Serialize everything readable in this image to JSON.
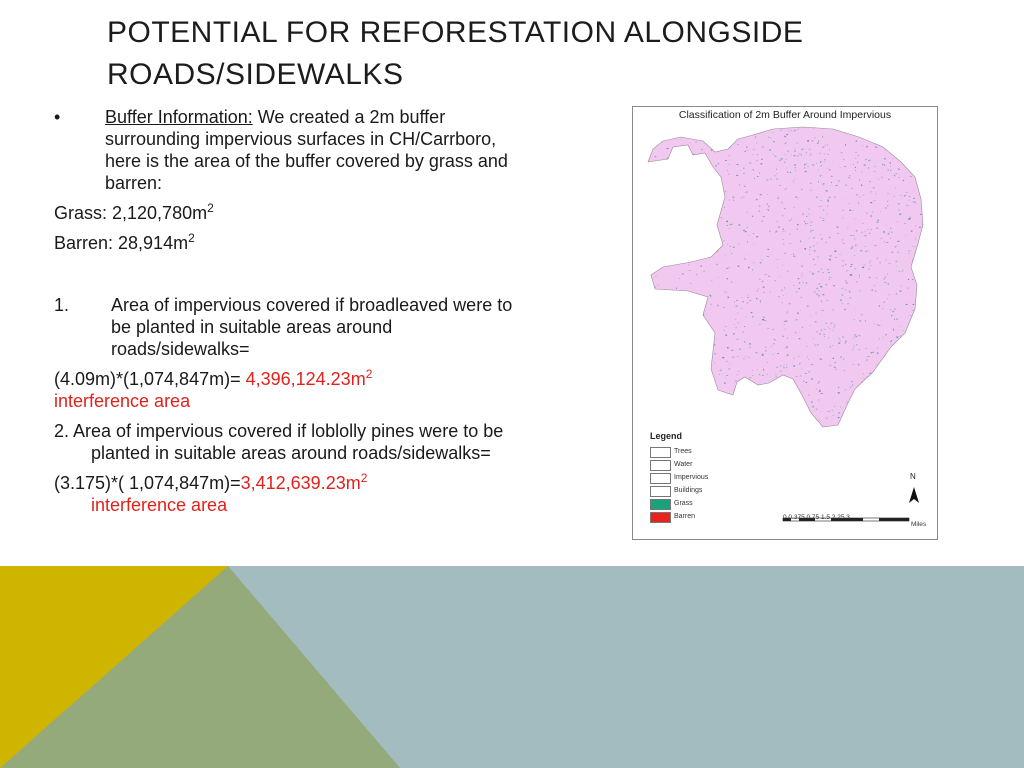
{
  "title": {
    "line1": "POTENTIAL FOR REFORESTATION ALONGSIDE",
    "line2": "ROADS/SIDEWALKS"
  },
  "buffer": {
    "bullet": "•",
    "label": "Buffer Information:",
    "text": "  We created a 2m buffer surrounding impervious surfaces in CH/Carrboro, here is the area of the buffer covered by grass and barren:"
  },
  "grass": {
    "label": "Grass: 2,120,780m",
    "sup": "2"
  },
  "barren": {
    "label": "Barren: 28,914m",
    "sup": "2"
  },
  "item1": {
    "marker": "1.",
    "text": "Area of impervious covered if broadleaved were to be planted in suitable areas around roads/sidewalks=",
    "calc": "(4.09m)*(1,074,847m)= ",
    "result": "4,396,124.23m",
    "result_sup": "2",
    "result_label": "interference area"
  },
  "item2": {
    "text": "2. Area of impervious covered if loblolly pines were to be planted in suitable areas around roads/sidewalks=",
    "calc": "(3.175)*( 1,074,847m)=",
    "result": "3,412,639.23m",
    "result_sup": "2",
    "result_label": "interference area"
  },
  "map": {
    "title": "Classification of 2m Buffer Around Impervious",
    "legend_title": "Legend",
    "legend": [
      {
        "label": "Trees",
        "color": "#ffffff"
      },
      {
        "label": "Water",
        "color": "#ffffff"
      },
      {
        "label": "Impervious",
        "color": "#ffffff"
      },
      {
        "label": "Buildings",
        "color": "#ffffff"
      },
      {
        "label": "Grass",
        "color": "#1aa37a"
      },
      {
        "label": "Barren",
        "color": "#e8231f"
      }
    ],
    "scale_ticks": "0  0.375 0.75      1.5        2.25        3",
    "scale_unit": "Miles",
    "north": "N",
    "fill_color": "#f1c8ef",
    "speckle_color": "#3d7fa6"
  },
  "colors": {
    "accent_red": "#e3211c",
    "band_yellow": "#cfb500",
    "band_green": "#94aa7b",
    "band_gray": "#a2bcbf"
  }
}
